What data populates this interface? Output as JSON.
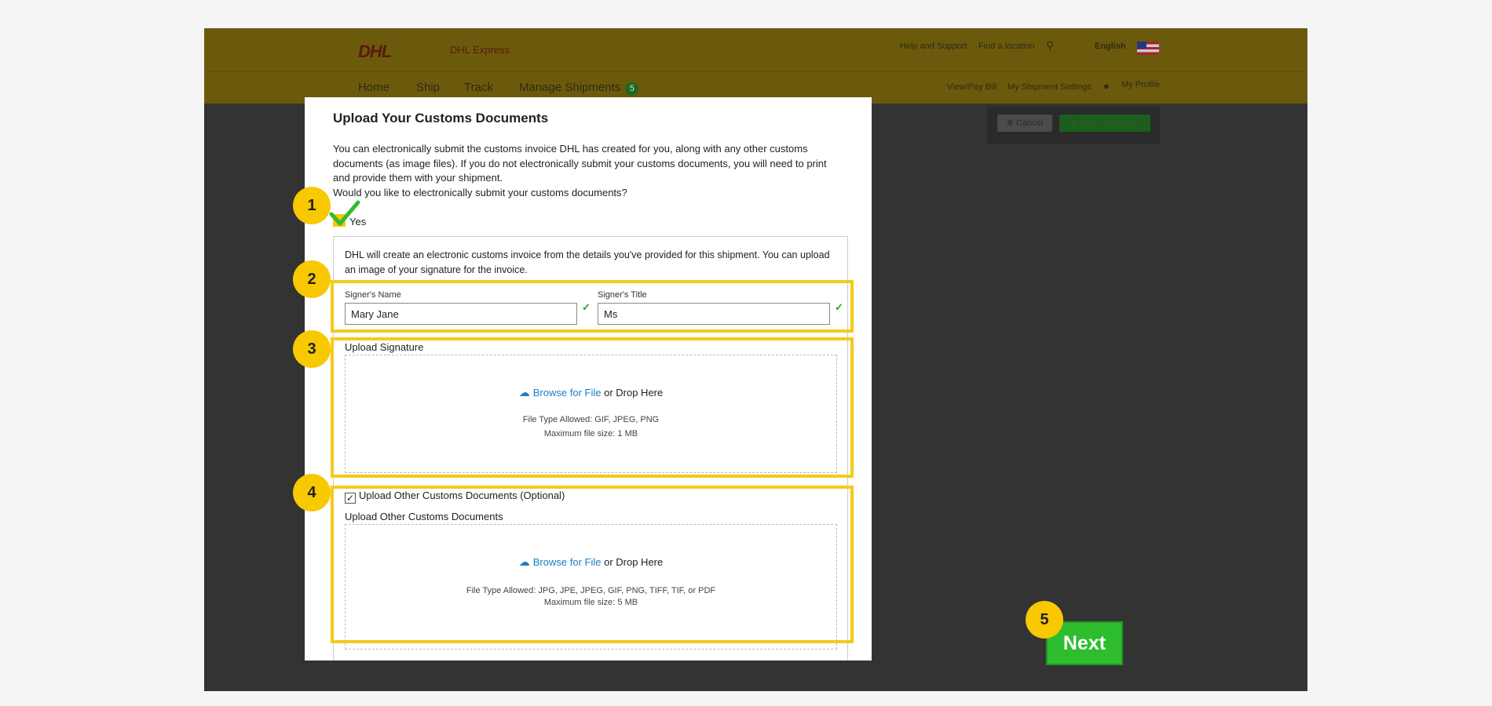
{
  "header": {
    "logo": "DHL",
    "brand_name": "DHL Express",
    "utility_links": [
      "Help and Support",
      "Find a location"
    ],
    "language": "English"
  },
  "nav": {
    "items": [
      "Home",
      "Ship",
      "Track",
      "Manage Shipments"
    ],
    "manage_badge": "5",
    "sub_links": [
      "View/Pay Bill",
      "My Shipment Settings",
      "My Profile"
    ]
  },
  "actions": {
    "cancel": "Cancel",
    "save": "Save for Later"
  },
  "modal": {
    "title": "Upload Your Customs Documents",
    "intro": "You can electronically submit the customs invoice DHL has created for you, along with any other customs documents (as image files). If you do not electronically submit your customs documents, you will need to print and provide them with your shipment.",
    "question": "Would you like to electronically submit your customs documents?",
    "yes_label": "Yes",
    "info": "DHL will create an electronic customs invoice from the details you've provided for this shipment. You can upload an image of your signature for the invoice.",
    "signer_name_label": "Signer's Name",
    "signer_name_value": "Mary Jane",
    "signer_title_label": "Signer's Title",
    "signer_title_value": "Ms",
    "upload_signature": {
      "label": "Upload Signature",
      "browse": "Browse for File",
      "drop": "or Drop Here",
      "types": "File Type Allowed: GIF, JPEG, PNG",
      "max": "Maximum file size: 1 MB"
    },
    "other_docs_checkbox": "Upload Other Customs Documents (Optional)",
    "upload_other": {
      "label": "Upload Other Customs Documents",
      "browse": "Browse for File",
      "drop": "or Drop Here",
      "types": "File Type Allowed: JPG, JPE, JPEG, GIF, PNG, TIFF, TIF, or PDF",
      "max": "Maximum file size: 5 MB"
    }
  },
  "markers": [
    "1",
    "2",
    "3",
    "4",
    "5"
  ],
  "next_button": "Next",
  "colors": {
    "highlight": "#f7c91a",
    "marker": "#f8c800",
    "next": "#2ebd2e",
    "link": "#1a7fc4"
  }
}
